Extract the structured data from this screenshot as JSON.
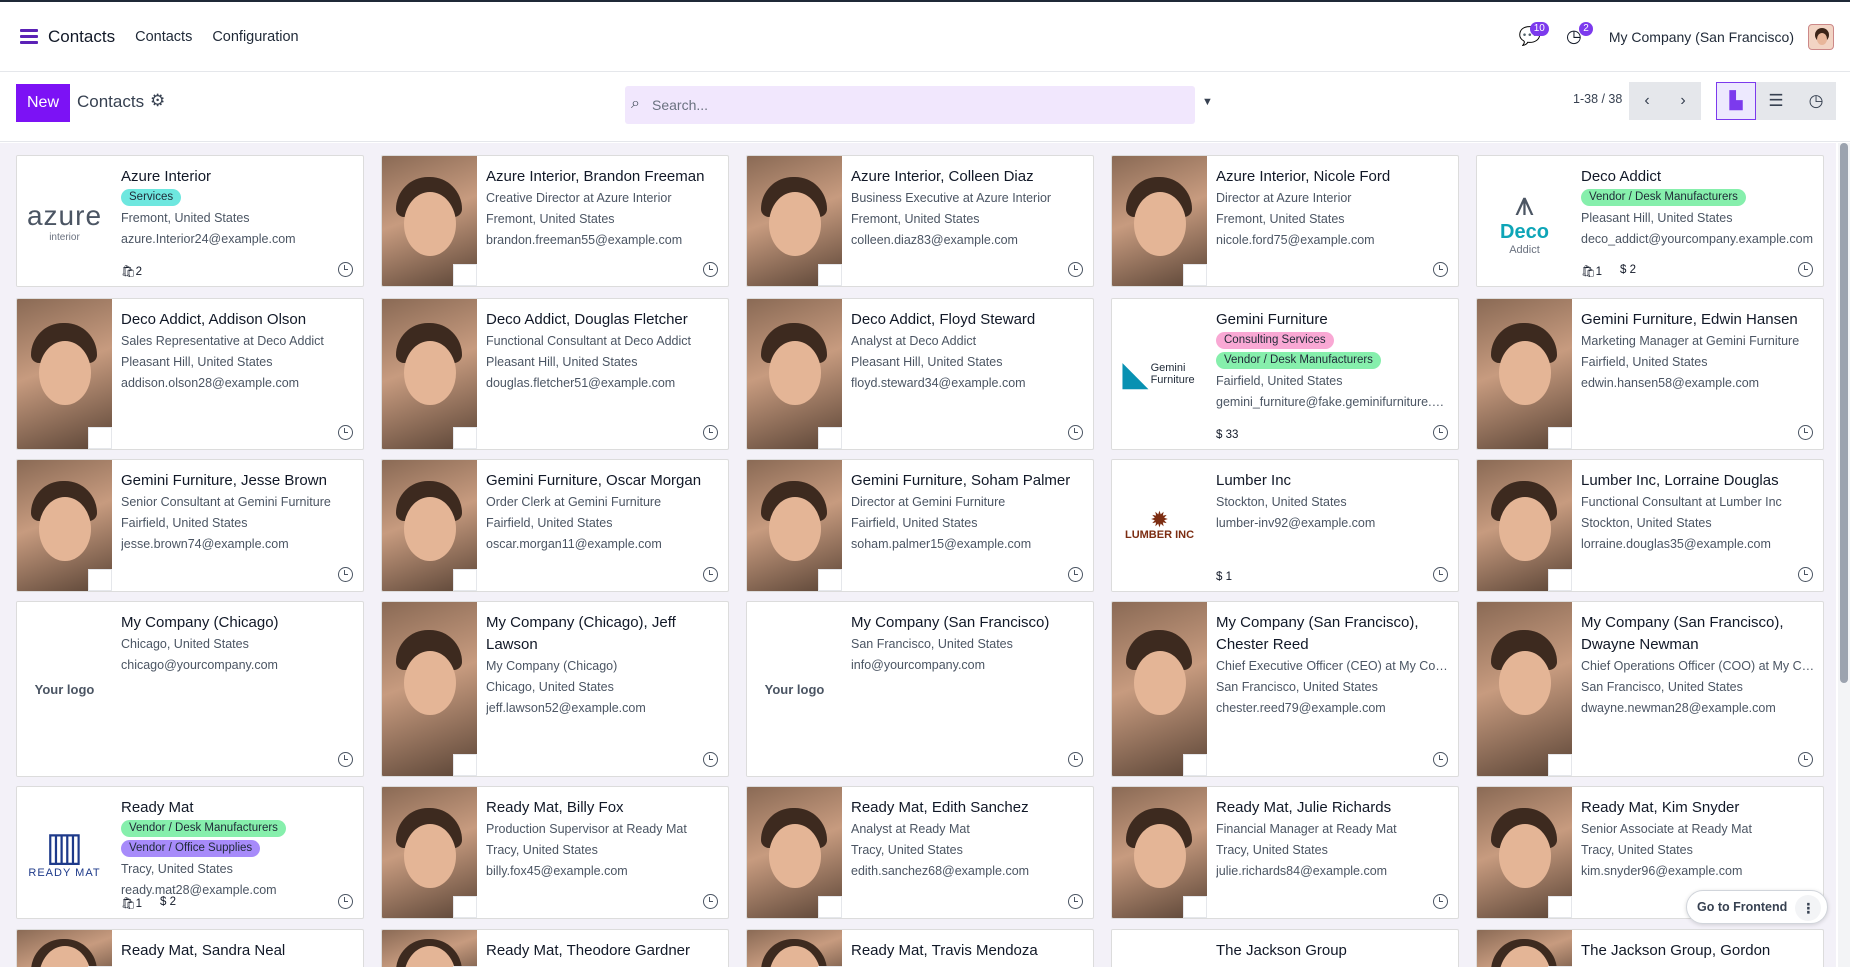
{
  "nav": {
    "app_name": "Contacts",
    "menu_items": [
      "Contacts",
      "Configuration"
    ],
    "chat_badge": "10",
    "activity_badge": "2",
    "company": "My Company (San Francisco)"
  },
  "controls": {
    "new_label": "New",
    "title": "Contacts",
    "search_placeholder": "Search...",
    "pager": "1-38 / 38"
  },
  "cards": [
    {
      "name": "Azure Interior",
      "tags": [
        {
          "label": "Services",
          "color": "teal"
        }
      ],
      "lines": [
        "Fremont, United States",
        "azure.Interior24@example.com"
      ],
      "footer": [
        "🛍2"
      ],
      "image": "logo-azure"
    },
    {
      "name": "Azure Interior, Brandon Freeman",
      "tags": [],
      "lines": [
        "Creative Director at Azure Interior",
        "Fremont, United States",
        "brandon.freeman55@example.com"
      ],
      "footer": [],
      "image": "photo"
    },
    {
      "name": "Azure Interior, Colleen Diaz",
      "tags": [],
      "lines": [
        "Business Executive at Azure Interior",
        "Fremont, United States",
        "colleen.diaz83@example.com"
      ],
      "footer": [],
      "image": "photo"
    },
    {
      "name": "Azure Interior, Nicole Ford",
      "tags": [],
      "lines": [
        "Director at Azure Interior",
        "Fremont, United States",
        "nicole.ford75@example.com"
      ],
      "footer": [],
      "image": "photo"
    },
    {
      "name": "Deco Addict",
      "tags": [
        {
          "label": "Vendor / Desk Manufacturers",
          "color": "green"
        }
      ],
      "lines": [
        "Pleasant Hill, United States",
        "deco_addict@yourcompany.example.com"
      ],
      "footer": [
        "🛍1",
        "$ 2"
      ],
      "image": "logo-deco"
    },
    {
      "name": "Deco Addict, Addison Olson",
      "tags": [],
      "lines": [
        "Sales Representative at Deco Addict",
        "Pleasant Hill, United States",
        "addison.olson28@example.com"
      ],
      "footer": [],
      "image": "photo"
    },
    {
      "name": "Deco Addict, Douglas Fletcher",
      "tags": [],
      "lines": [
        "Functional Consultant at Deco Addict",
        "Pleasant Hill, United States",
        "douglas.fletcher51@example.com"
      ],
      "footer": [],
      "image": "photo"
    },
    {
      "name": "Deco Addict, Floyd Steward",
      "tags": [],
      "lines": [
        "Analyst at Deco Addict",
        "Pleasant Hill, United States",
        "floyd.steward34@example.com"
      ],
      "footer": [],
      "image": "photo"
    },
    {
      "name": "Gemini Furniture",
      "tags": [
        {
          "label": "Consulting Services",
          "color": "pink"
        },
        {
          "label": "Vendor / Desk Manufacturers",
          "color": "green"
        }
      ],
      "lines": [
        "Fairfield, United States",
        "gemini_furniture@fake.geminifurniture.com"
      ],
      "footer": [
        "$ 33"
      ],
      "image": "logo-gemini"
    },
    {
      "name": "Gemini Furniture, Edwin Hansen",
      "tags": [],
      "lines": [
        "Marketing Manager at Gemini Furniture",
        "Fairfield, United States",
        "edwin.hansen58@example.com"
      ],
      "footer": [],
      "image": "photo"
    },
    {
      "name": "Gemini Furniture, Jesse Brown",
      "tags": [],
      "lines": [
        "Senior Consultant at Gemini Furniture",
        "Fairfield, United States",
        "jesse.brown74@example.com"
      ],
      "footer": [],
      "image": "photo"
    },
    {
      "name": "Gemini Furniture, Oscar Morgan",
      "tags": [],
      "lines": [
        "Order Clerk at Gemini Furniture",
        "Fairfield, United States",
        "oscar.morgan11@example.com"
      ],
      "footer": [],
      "image": "photo"
    },
    {
      "name": "Gemini Furniture, Soham Palmer",
      "tags": [],
      "lines": [
        "Director at Gemini Furniture",
        "Fairfield, United States",
        "soham.palmer15@example.com"
      ],
      "footer": [],
      "image": "photo"
    },
    {
      "name": "Lumber Inc",
      "tags": [],
      "lines": [
        "Stockton, United States",
        "lumber-inv92@example.com"
      ],
      "footer": [
        "$ 1"
      ],
      "image": "logo-lumber"
    },
    {
      "name": "Lumber Inc, Lorraine Douglas",
      "tags": [],
      "lines": [
        "Functional Consultant at Lumber Inc",
        "Stockton, United States",
        "lorraine.douglas35@example.com"
      ],
      "footer": [],
      "image": "photo"
    },
    {
      "name": "My Company (Chicago)",
      "tags": [],
      "lines": [
        "Chicago, United States",
        "chicago@yourcompany.com"
      ],
      "footer": [],
      "image": "logo-yourlogo"
    },
    {
      "name": "My Company (Chicago), Jeff Lawson",
      "tags": [],
      "lines": [
        "My Company (Chicago)",
        "Chicago, United States",
        "jeff.lawson52@example.com"
      ],
      "footer": [],
      "image": "photo"
    },
    {
      "name": "My Company (San Francisco)",
      "tags": [],
      "lines": [
        "San Francisco, United States",
        "info@yourcompany.com"
      ],
      "footer": [],
      "image": "logo-yourlogo"
    },
    {
      "name": "My Company (San Francisco), Chester Reed",
      "tags": [],
      "lines": [
        "Chief Executive Officer (CEO) at My Company (San Francisco)",
        "San Francisco, United States",
        "chester.reed79@example.com"
      ],
      "footer": [],
      "image": "photo"
    },
    {
      "name": "My Company (San Francisco), Dwayne Newman",
      "tags": [],
      "lines": [
        "Chief Operations Officer (COO) at My Company (San Francisco)",
        "San Francisco, United States",
        "dwayne.newman28@example.com"
      ],
      "footer": [],
      "image": "photo"
    },
    {
      "name": "Ready Mat",
      "tags": [
        {
          "label": "Vendor / Desk Manufacturers",
          "color": "green"
        },
        {
          "label": "Vendor / Office Supplies",
          "color": "purple"
        }
      ],
      "lines": [
        "Tracy, United States",
        "ready.mat28@example.com"
      ],
      "footer": [
        "🛍1",
        "$ 2"
      ],
      "image": "logo-readymat"
    },
    {
      "name": "Ready Mat, Billy Fox",
      "tags": [],
      "lines": [
        "Production Supervisor at Ready Mat",
        "Tracy, United States",
        "billy.fox45@example.com"
      ],
      "footer": [],
      "image": "photo"
    },
    {
      "name": "Ready Mat, Edith Sanchez",
      "tags": [],
      "lines": [
        "Analyst at Ready Mat",
        "Tracy, United States",
        "edith.sanchez68@example.com"
      ],
      "footer": [],
      "image": "photo"
    },
    {
      "name": "Ready Mat, Julie Richards",
      "tags": [],
      "lines": [
        "Financial Manager at Ready Mat",
        "Tracy, United States",
        "julie.richards84@example.com"
      ],
      "footer": [],
      "image": "photo"
    },
    {
      "name": "Ready Mat, Kim Snyder",
      "tags": [],
      "lines": [
        "Senior Associate at Ready Mat",
        "Tracy, United States",
        "kim.snyder96@example.com"
      ],
      "footer": [],
      "image": "photo"
    },
    {
      "name": "Ready Mat, Sandra Neal",
      "tags": [],
      "lines": [],
      "footer": [],
      "image": "photo"
    },
    {
      "name": "Ready Mat, Theodore Gardner",
      "tags": [],
      "lines": [],
      "footer": [],
      "image": "photo"
    },
    {
      "name": "Ready Mat, Travis Mendoza",
      "tags": [],
      "lines": [],
      "footer": [],
      "image": "photo"
    },
    {
      "name": "The Jackson Group",
      "tags": [],
      "lines": [],
      "footer": [],
      "image": "logo-blank"
    },
    {
      "name": "The Jackson Group, Gordon",
      "tags": [],
      "lines": [],
      "footer": [],
      "image": "photo"
    }
  ],
  "logos": {
    "azure": "azure",
    "azure_sub": "interior",
    "deco": "Deco",
    "deco_sub": "Addict",
    "gemini": "Gemini Furniture",
    "lumber": "LUMBER INC",
    "readymat": "READY MAT",
    "yourlogo": "Your logo"
  },
  "go_frontend": "Go to Frontend"
}
